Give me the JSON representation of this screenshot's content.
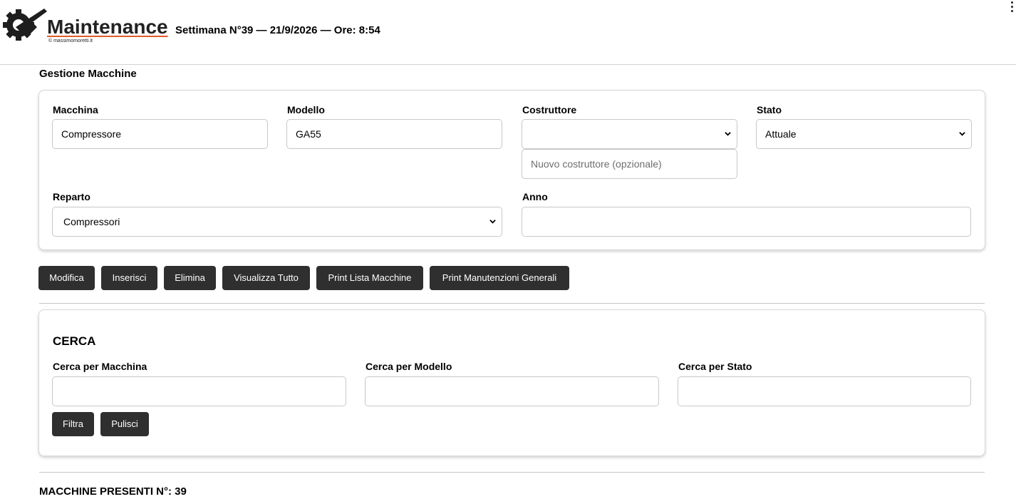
{
  "header": {
    "brand": "Maintenance",
    "copyright": "© massimomoretti.it",
    "week_info": "Settimana N°39 — 21/9/2026 — Ore: 8:54"
  },
  "section_title": "Gestione Macchine",
  "form": {
    "macchina": {
      "label": "Macchina",
      "value": "Compressore"
    },
    "modello": {
      "label": "Modello",
      "value": "GA55"
    },
    "costruttore": {
      "label": "Costruttore",
      "value": "",
      "new_placeholder": "Nuovo costruttore (opzionale)"
    },
    "stato": {
      "label": "Stato",
      "value": "Attuale"
    },
    "reparto": {
      "label": "Reparto",
      "value": "Compressori"
    },
    "anno": {
      "label": "Anno",
      "value": ""
    }
  },
  "actions": {
    "modifica": "Modifica",
    "inserisci": "Inserisci",
    "elimina": "Elimina",
    "visualizza_tutto": "Visualizza Tutto",
    "print_lista": "Print Lista Macchine",
    "print_manutenzioni": "Print Manutenzioni Generali"
  },
  "search": {
    "title": "CERCA",
    "per_macchina": {
      "label": "Cerca per Macchina",
      "value": ""
    },
    "per_modello": {
      "label": "Cerca per Modello",
      "value": ""
    },
    "per_stato": {
      "label": "Cerca per Stato",
      "value": ""
    },
    "filtra": "Filtra",
    "pulisci": "Pulisci"
  },
  "count_label": "MACCHINE PRESENTI N°: 39",
  "colors": {
    "button_bg": "#2f2f2f",
    "accent": "#e05a2b"
  },
  "icons": {
    "logo": "gear-wrench-icon",
    "menu": "kebab-menu-icon",
    "select": "chevron-down-icon"
  }
}
